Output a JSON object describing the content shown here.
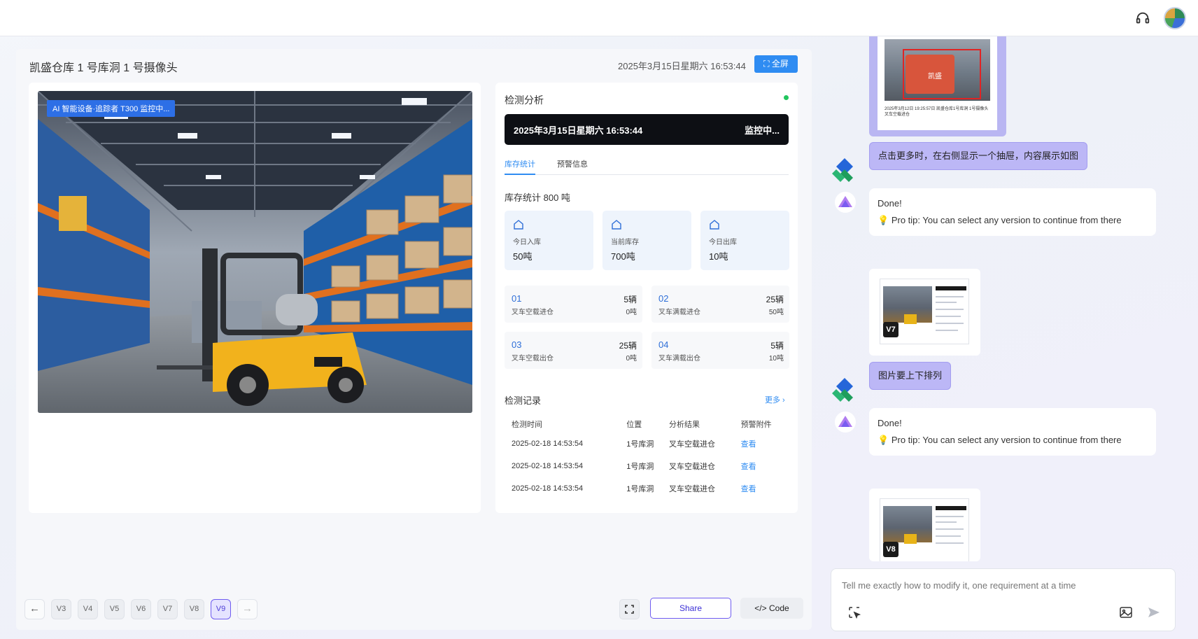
{
  "topbar": {
    "support_icon": "headset-icon",
    "avatar_icon": "user-avatar"
  },
  "preview": {
    "title": "凯盛仓库 1 号库洞 1 号摄像头",
    "datetime": "2025年3月15日星期六 16:53:44",
    "fullscreen_label": "全屏",
    "camera_badge": "AI 智能设备·追踪者 T300 监控中...",
    "detection": {
      "title": "检测分析",
      "banner_time": "2025年3月15日星期六 16:53:44",
      "banner_status": "监控中...",
      "tabs": [
        {
          "label": "库存统计",
          "active": true
        },
        {
          "label": "预警信息",
          "active": false
        }
      ],
      "stock_title": "库存统计 800 吨",
      "stats": [
        {
          "label": "今日入库",
          "value": "50吨"
        },
        {
          "label": "当前库存",
          "value": "700吨"
        },
        {
          "label": "今日出库",
          "value": "10吨"
        }
      ],
      "lanes": [
        {
          "no": "01",
          "name": "叉车空载进仓",
          "count": "5辆",
          "weight": "0吨"
        },
        {
          "no": "02",
          "name": "叉车满载进仓",
          "count": "25辆",
          "weight": "50吨"
        },
        {
          "no": "03",
          "name": "叉车空载出仓",
          "count": "25辆",
          "weight": "0吨"
        },
        {
          "no": "04",
          "name": "叉车满载出仓",
          "count": "5辆",
          "weight": "10吨"
        }
      ],
      "records_title": "检测记录",
      "records_more": "更多 ›",
      "records_headers": [
        "检测时间",
        "位置",
        "分析结果",
        "预警附件"
      ],
      "records": [
        {
          "time": "2025-02-18 14:53:54",
          "place": "1号库洞",
          "result": "叉车空载进仓",
          "attach": "查看"
        },
        {
          "time": "2025-02-18 14:53:54",
          "place": "1号库洞",
          "result": "叉车空载进仓",
          "attach": "查看"
        },
        {
          "time": "2025-02-18 14:53:54",
          "place": "1号库洞",
          "result": "叉车空载进仓",
          "attach": "查看"
        }
      ]
    }
  },
  "bottombar": {
    "versions": [
      "V3",
      "V4",
      "V5",
      "V6",
      "V7",
      "V8",
      "V9"
    ],
    "active_version": "V9",
    "prev_symbol": "←",
    "next_symbol": "→",
    "share_label": "Share",
    "code_label": "Code"
  },
  "chat": {
    "thumbnail_caption": "2025年3月12日 19:25:57日 凯盛仓库1号库洞 1号摄像头 叉车空载进仓",
    "thumbnail_sign": "凯盛",
    "messages": [
      {
        "role": "user",
        "text": "点击更多时，在右侧显示一个抽屉，内容展示如图"
      },
      {
        "role": "assistant",
        "done": "Done!",
        "tip": "Pro tip: You can select any version to continue from there",
        "version": "V7"
      },
      {
        "role": "user",
        "text": "图片要上下排列"
      },
      {
        "role": "assistant",
        "done": "Done!",
        "tip": "Pro tip: You can select any version to continue from there",
        "version": "V8"
      }
    ],
    "composer_placeholder": "Tell me exactly how to modify it, one requirement at a time"
  },
  "colors": {
    "accent": "#2f8cf2",
    "brand_purple": "#6f5cf0",
    "user_bubble": "#bcb7f6"
  }
}
